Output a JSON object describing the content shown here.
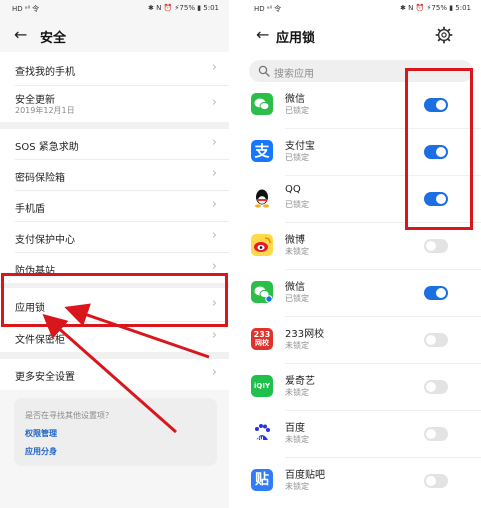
{
  "left": {
    "status_left": "HD ᵃˡˡ 令",
    "status_right": "✱ N ⏰ ⚡75% ▮ 5:01",
    "title": "安全",
    "items": [
      {
        "label": "查找我的手机"
      },
      {
        "label": "安全更新",
        "sub": "2019年12月1日"
      },
      {
        "label": "SOS 紧急求助"
      },
      {
        "label": "密码保险箱"
      },
      {
        "label": "手机盾"
      },
      {
        "label": "支付保护中心"
      },
      {
        "label": "防伪基站"
      },
      {
        "label": "应用锁"
      },
      {
        "label": "文件保密柜"
      },
      {
        "label": "更多安全设置"
      }
    ],
    "hint": {
      "question": "是否在寻找其他设置项？",
      "link1": "权限管理",
      "link2": "应用分身"
    }
  },
  "right": {
    "status_left": "HD ᵃˡˡ 令",
    "status_right": "✱ N ⏰ ⚡75% ▮ 5:01",
    "title": "应用锁",
    "search_placeholder": "搜索应用",
    "apps": [
      {
        "name": "微信",
        "status": "已锁定",
        "on": true,
        "icon": "wechat-icon"
      },
      {
        "name": "支付宝",
        "status": "已锁定",
        "on": true,
        "icon": "alipay-icon"
      },
      {
        "name": "QQ",
        "status": "已锁定",
        "on": true,
        "icon": "qq-icon"
      },
      {
        "name": "微博",
        "status": "未锁定",
        "on": false,
        "icon": "weibo-icon"
      },
      {
        "name": "微信",
        "status": "已锁定",
        "on": true,
        "icon": "wechat-clone-icon"
      },
      {
        "name": "233网校",
        "status": "未锁定",
        "on": false,
        "icon": "233-icon"
      },
      {
        "name": "爱奇艺",
        "status": "未锁定",
        "on": false,
        "icon": "iqiyi-icon"
      },
      {
        "name": "百度",
        "status": "未锁定",
        "on": false,
        "icon": "baidu-icon"
      },
      {
        "name": "百度贴吧",
        "status": "未锁定",
        "on": false,
        "icon": "tieba-icon"
      }
    ],
    "icon_text": {
      "alipay": "支",
      "n233": "233",
      "n233_sub": "网校",
      "iqiyi": "iQIY",
      "tieba": "贴",
      "baidu": "du"
    }
  },
  "colors": {
    "annotation_red": "#d8161c",
    "toggle_on": "#1b6fe3",
    "link_blue": "#1e63c8"
  }
}
